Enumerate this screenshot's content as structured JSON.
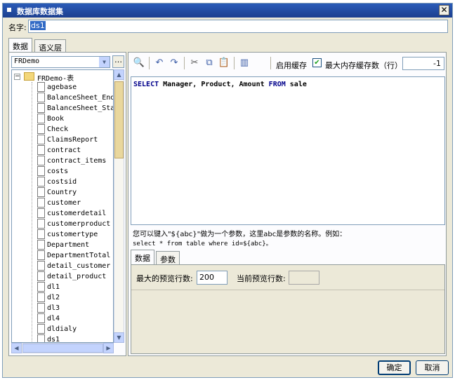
{
  "window": {
    "title": "数据库数据集"
  },
  "name_field": {
    "label": "名字:",
    "value": "ds1"
  },
  "top_tabs": [
    {
      "label": "数据"
    },
    {
      "label": "语义层"
    }
  ],
  "database": {
    "selected": "FRDemo"
  },
  "tree": {
    "root": "FRDemo-表",
    "items": [
      "agebase",
      "BalanceSheet_End",
      "BalanceSheet_Star",
      "Book",
      "Check",
      "ClaimsReport",
      "contract",
      "contract_items",
      "costs",
      "costsid",
      "Country",
      "customer",
      "customerdetail",
      "customerproduct",
      "customertype",
      "Department",
      "DepartmentTotal",
      "detail_customer",
      "detail_product",
      "dl1",
      "dl2",
      "dl3",
      "dl4",
      "dldialy",
      "ds1"
    ]
  },
  "toolbar": {
    "cache_label": "启用缓存",
    "cache_checked": true,
    "max_cache_label": "最大内存缓存数（行）",
    "max_cache_value": "-1"
  },
  "sql": {
    "keyword_select": "SELECT",
    "fields": " Manager, Product, Amount ",
    "keyword_from": "FROM",
    "table": " sale"
  },
  "hint": {
    "line1": "您可以键入\"${abc}\"做为一个参数，这里abc是参数的名称。例如：",
    "line2": "select * from table where id=${abc}。"
  },
  "sub_tabs": [
    {
      "label": "数据"
    },
    {
      "label": "参数"
    }
  ],
  "preview": {
    "max_rows_label": "最大的预览行数:",
    "max_rows_value": "200",
    "current_rows_label": "当前预览行数:"
  },
  "buttons": {
    "ok": "确定",
    "cancel": "取消"
  }
}
